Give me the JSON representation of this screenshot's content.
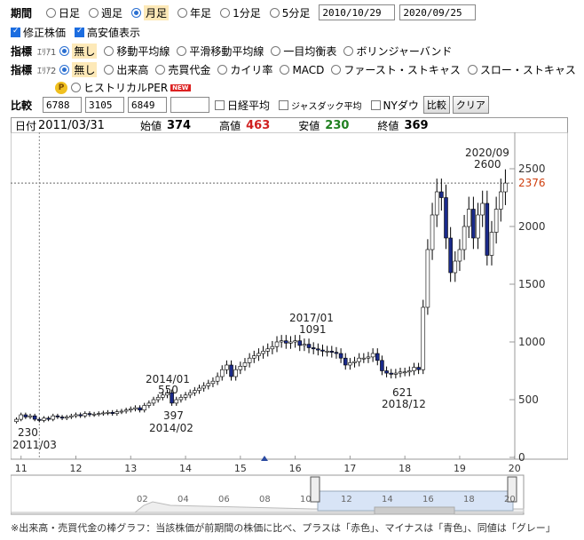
{
  "period": {
    "label": "期間",
    "options": [
      "日足",
      "週足",
      "月足",
      "年足",
      "1分足",
      "5分足"
    ],
    "selected": 2,
    "from": "2010/10/29",
    "to": "2020/09/25"
  },
  "checks": [
    {
      "label": "修正株価",
      "checked": true
    },
    {
      "label": "高安値表示",
      "checked": true
    }
  ],
  "area1": {
    "label": "指標",
    "sub": "ｴﾘｱ1",
    "options": [
      "無し",
      "移動平均線",
      "平滑移動平均線",
      "一目均衡表",
      "ボリンジャーバンド"
    ],
    "selected": 0
  },
  "area2": {
    "label": "指標",
    "sub": "ｴﾘｱ2",
    "options": [
      "無し",
      "出来高",
      "売買代金",
      "カイリ率",
      "MACD",
      "ファースト・ストキャス",
      "スロー・ストキャス"
    ],
    "selected": 0,
    "extra": "ヒストリカルPER",
    "new_badge": "NEW",
    "p_icon": "P"
  },
  "compare": {
    "label": "比較",
    "codes": [
      "6788",
      "3105",
      "6849",
      ""
    ],
    "checks": [
      "日経平均",
      "ジャスダック平均",
      "NYダウ"
    ],
    "compare_btn": "比較",
    "clear_btn": "クリア"
  },
  "info": {
    "date_label": "日付",
    "date": "2011/03/31",
    "open_label": "始値",
    "open": "374",
    "high_label": "高値",
    "high": "463",
    "low_label": "安値",
    "low": "230",
    "close_label": "終値",
    "close": "369",
    "high_color": "#d02020",
    "low_color": "#208020"
  },
  "chart_data": {
    "type": "candlestick",
    "period": "monthly",
    "x_ticks": [
      "11",
      "12",
      "13",
      "14",
      "15",
      "16",
      "17",
      "18",
      "19",
      "20"
    ],
    "y_ticks": [
      0,
      500,
      1000,
      1500,
      2000,
      2500
    ],
    "ylim": [
      0,
      2700
    ],
    "current_price": "2376",
    "annotations": [
      {
        "text": "230",
        "value": 230,
        "date": "2011/03"
      },
      {
        "text": "2011/03",
        "value": 230
      },
      {
        "text": "2014/01",
        "value": 550
      },
      {
        "text": "550",
        "value": 550
      },
      {
        "text": "397",
        "value": 397
      },
      {
        "text": "2014/02",
        "value": 397
      },
      {
        "text": "2017/01",
        "value": 1091
      },
      {
        "text": "1091",
        "value": 1091
      },
      {
        "text": "621",
        "value": 621
      },
      {
        "text": "2018/12",
        "value": 621
      },
      {
        "text": "2020/09",
        "value": 2600
      },
      {
        "text": "2600",
        "value": 2600
      }
    ],
    "closes": [
      330,
      369,
      350,
      360,
      330,
      320,
      340,
      330,
      360,
      350,
      340,
      350,
      360,
      370,
      360,
      380,
      370,
      375,
      380,
      385,
      390,
      380,
      395,
      400,
      410,
      420,
      430,
      410,
      450,
      470,
      500,
      520,
      540,
      560,
      470,
      500,
      520,
      540,
      560,
      580,
      600,
      620,
      640,
      660,
      700,
      760,
      800,
      700,
      760,
      790,
      820,
      860,
      880,
      900,
      920,
      940,
      960,
      1000,
      1010,
      990,
      1000,
      1010,
      970,
      980,
      950,
      940,
      930,
      920,
      920,
      910,
      900,
      860,
      800,
      820,
      830,
      860,
      860,
      870,
      900,
      840,
      750,
      730,
      720,
      730,
      740,
      740,
      750,
      780,
      760,
      1300,
      1800,
      2100,
      2300,
      2250,
      1900,
      1600,
      1700,
      1800,
      2000,
      2150,
      1900,
      2100,
      2200,
      1750,
      1950,
      2150,
      2300,
      2376
    ],
    "colors": {
      "up": "#ffffff",
      "down": "#1a2a8a",
      "line": "#000000",
      "current": "#d04010"
    }
  },
  "navigator": {
    "labels": [
      "02",
      "04",
      "06",
      "08",
      "10",
      "12",
      "14",
      "16",
      "18",
      "20"
    ]
  },
  "footnote": "※出来高・売買代金の棒グラフ：当該株価が前期間の株価に比べ、プラスは「赤色」、マイナスは「青色」、同値は「グレー」"
}
